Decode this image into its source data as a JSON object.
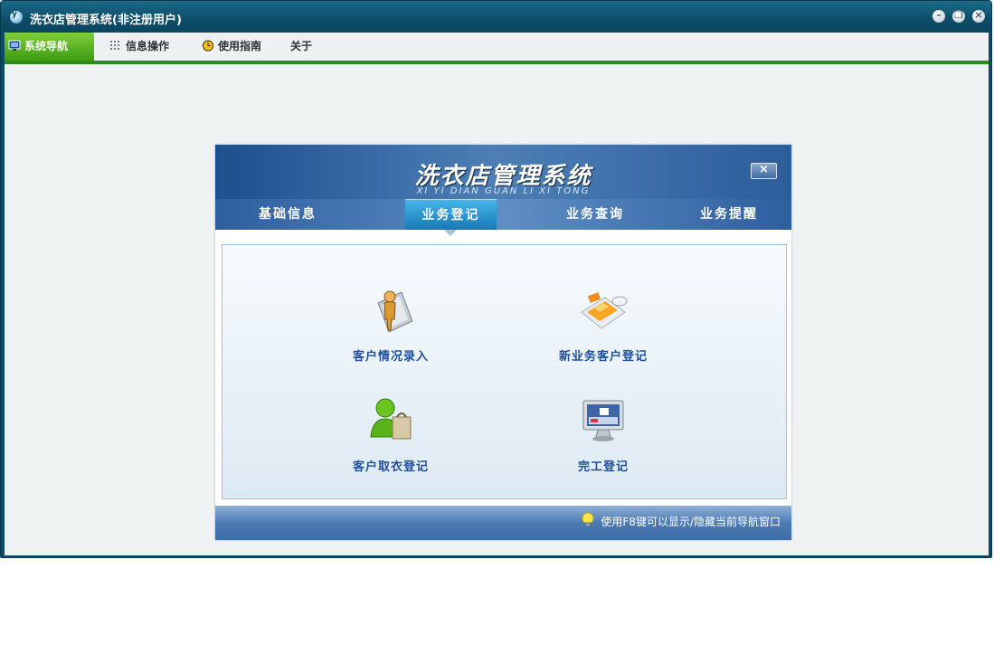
{
  "window": {
    "title": "洗衣店管理系统(非注册用户)",
    "app_icon_text": "y",
    "controls": [
      "minimize-icon",
      "restore-icon",
      "close-icon"
    ]
  },
  "menubar": {
    "items": [
      {
        "label": "系统导航",
        "icon": "monitor-icon",
        "active": true
      },
      {
        "label": "信息操作",
        "icon": "grid-icon",
        "active": false
      },
      {
        "label": "使用指南",
        "icon": "clock-icon",
        "active": false
      },
      {
        "label": "关于",
        "icon": "",
        "active": false
      }
    ],
    "accent_color": "#2d8a1c"
  },
  "panel": {
    "title": "洗衣店管理系统",
    "subtitle": "XI YI DIAN GUAN LI XI TONG",
    "close_symbol": "×",
    "tabs": [
      {
        "label": "基础信息",
        "active": false
      },
      {
        "label": "业务登记",
        "active": true
      },
      {
        "label": "业务查询",
        "active": false
      },
      {
        "label": "业务提醒",
        "active": false
      }
    ],
    "items": [
      {
        "label": "客户情况录入",
        "icon": "person-icon"
      },
      {
        "label": "新业务客户登记",
        "icon": "card-mouse-icon"
      },
      {
        "label": "客户取衣登记",
        "icon": "shopping-bag-user-icon"
      },
      {
        "label": "完工登记",
        "icon": "computer-monitor-icon"
      }
    ],
    "footer_hint": "使用F8键可以显示/隐藏当前导航窗口"
  }
}
